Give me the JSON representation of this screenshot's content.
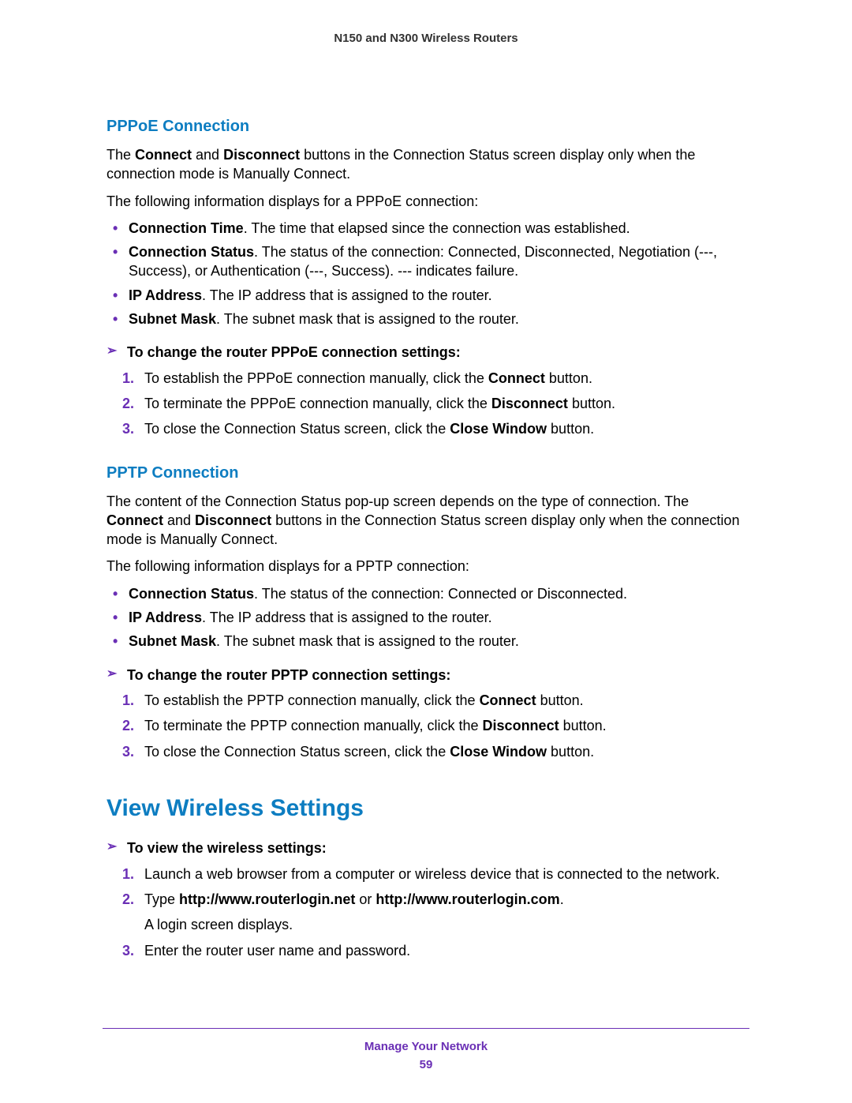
{
  "header": "N150 and N300 Wireless Routers",
  "pppoe": {
    "heading": "PPPoE Connection",
    "intro1_a": "The ",
    "intro1_b": "Connect",
    "intro1_c": " and ",
    "intro1_d": "Disconnect",
    "intro1_e": " buttons in the Connection Status screen display only when the connection mode is Manually Connect.",
    "intro2": "The following information displays for a PPPoE connection:",
    "bullets": {
      "b1_a": "Connection Time",
      "b1_b": ". The time that elapsed since the connection was established.",
      "b2_a": "Connection Status",
      "b2_b": ". The status of the connection: Connected, Disconnected, Negotiation (---, Success), or Authentication (---, Success). --- indicates failure.",
      "b3_a": "IP Address",
      "b3_b": ". The IP address that is assigned to the router.",
      "b4_a": "Subnet Mask",
      "b4_b": ". The subnet mask that is assigned to the router."
    },
    "proc_head": "To change the router PPPoE connection settings:",
    "steps": {
      "s1_a": "To establish the PPPoE connection manually, click the ",
      "s1_b": "Connect",
      "s1_c": " button.",
      "s2_a": "To terminate the PPPoE connection manually, click the ",
      "s2_b": "Disconnect",
      "s2_c": " button.",
      "s3_a": "To close the Connection Status screen, click the ",
      "s3_b": "Close Window",
      "s3_c": " button."
    }
  },
  "pptp": {
    "heading": "PPTP Connection",
    "intro1_a": "The content of the Connection Status pop-up screen depends on the type of connection. The ",
    "intro1_b": "Connect",
    "intro1_c": " and ",
    "intro1_d": "Disconnect",
    "intro1_e": " buttons in the Connection Status screen display only when the connection mode is Manually Connect.",
    "intro2": "The following information displays for a PPTP connection:",
    "bullets": {
      "b1_a": "Connection Status",
      "b1_b": ". The status of the connection: Connected or Disconnected.",
      "b2_a": "IP Address",
      "b2_b": ". The IP address that is assigned to the router.",
      "b3_a": "Subnet Mask",
      "b3_b": ". The subnet mask that is assigned to the router."
    },
    "proc_head": "To change the router PPTP connection settings:",
    "steps": {
      "s1_a": "To establish the PPTP connection manually, click the ",
      "s1_b": "Connect",
      "s1_c": " button.",
      "s2_a": "To terminate the PPTP connection manually, click the ",
      "s2_b": "Disconnect",
      "s2_c": " button.",
      "s3_a": "To close the Connection Status screen, click the ",
      "s3_b": "Close Window",
      "s3_c": " button."
    }
  },
  "wireless": {
    "heading": "View Wireless Settings",
    "proc_head": "To view the wireless settings:",
    "steps": {
      "s1": "Launch a web browser from a computer or wireless device that is connected to the network.",
      "s2_a": "Type ",
      "s2_b": "http://www.routerlogin.net",
      "s2_c": " or ",
      "s2_d": "http://www.routerlogin.com",
      "s2_e": ".",
      "s2_f": "A login screen displays.",
      "s3": "Enter the router user name and password."
    }
  },
  "footer": {
    "title": "Manage Your Network",
    "page": "59"
  }
}
